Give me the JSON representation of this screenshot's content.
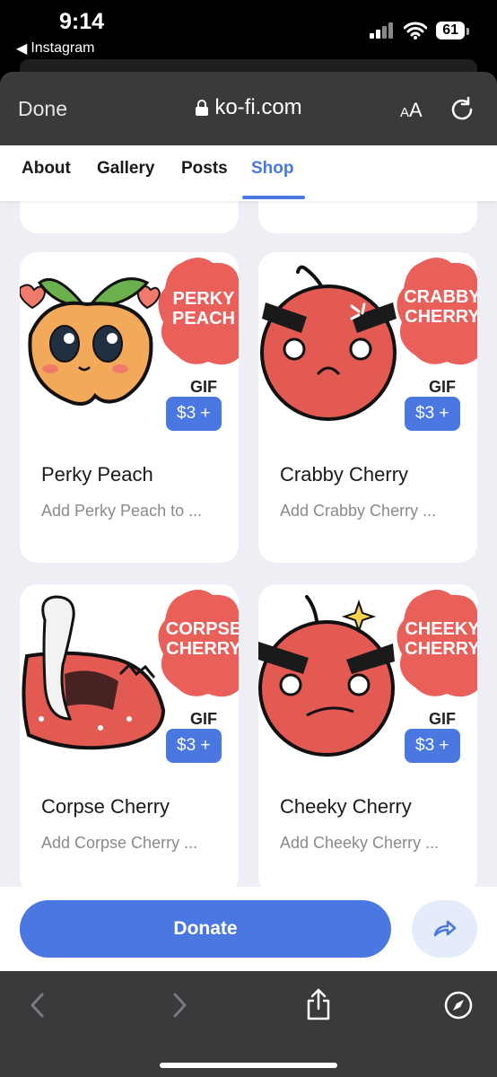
{
  "status": {
    "time": "9:14",
    "back_app": "Instagram",
    "battery": "61"
  },
  "browser": {
    "done": "Done",
    "url": "ko-fi.com",
    "text_size_small": "A",
    "text_size_large": "A"
  },
  "tabs": [
    {
      "label": "About"
    },
    {
      "label": "Gallery"
    },
    {
      "label": "Posts"
    },
    {
      "label": "Shop",
      "active": true
    }
  ],
  "products": [
    {
      "title": "Perky Peach",
      "desc": "Add Perky Peach to ...",
      "price": "$3 +",
      "art_title_1": "PERKY",
      "art_title_2": "PEACH",
      "art_tag": "GIF"
    },
    {
      "title": "Crabby Cherry",
      "desc": "Add Crabby Cherry ...",
      "price": "$3 +",
      "art_title_1": "CRABBY",
      "art_title_2": "CHERRY",
      "art_tag": "GIF"
    },
    {
      "title": "Corpse Cherry",
      "desc": "Add Corpse Cherry ...",
      "price": "$3 +",
      "art_title_1": "CORPSE",
      "art_title_2": "CHERRY",
      "art_tag": "GIF"
    },
    {
      "title": "Cheeky Cherry",
      "desc": "Add Cheeky Cherry ...",
      "price": "$3 +",
      "art_title_1": "CHEEKY",
      "art_title_2": "CHERRY",
      "art_tag": "GIF"
    }
  ],
  "action": {
    "donate": "Donate"
  },
  "colors": {
    "accent": "#4a78e0",
    "blob": "#e9605b",
    "cherry": "#e25a52",
    "peach": "#f2a95a"
  }
}
